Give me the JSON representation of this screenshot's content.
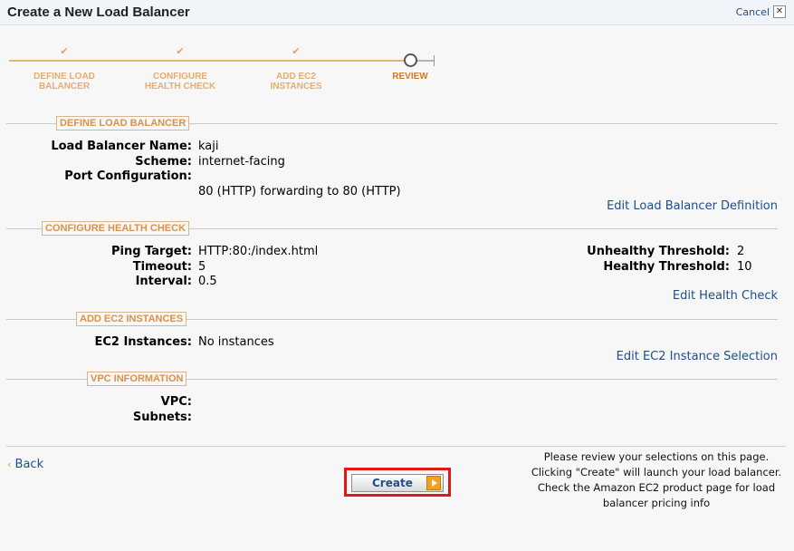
{
  "header": {
    "title": "Create a New Load Balancer",
    "cancel_label": "Cancel",
    "close_glyph": "✕"
  },
  "wizard": {
    "check_glyph": "✔",
    "steps": [
      {
        "line1": "DEFINE LOAD",
        "line2": "BALANCER",
        "status": "complete"
      },
      {
        "line1": "CONFIGURE",
        "line2": "HEALTH CHECK",
        "status": "complete"
      },
      {
        "line1": "ADD EC2",
        "line2": "INSTANCES",
        "status": "complete"
      },
      {
        "line1": "REVIEW",
        "line2": "",
        "status": "current"
      }
    ]
  },
  "sections": {
    "define": {
      "title": "DEFINE LOAD BALANCER",
      "name_label": "Load Balancer Name:",
      "name_value": "kaji",
      "scheme_label": "Scheme:",
      "scheme_value": "internet-facing",
      "port_label": "Port Configuration:",
      "port_value": "80 (HTTP) forwarding to 80 (HTTP)",
      "edit_link": "Edit Load Balancer Definition"
    },
    "health": {
      "title": "CONFIGURE HEALTH CHECK",
      "ping_label": "Ping Target:",
      "ping_value": "HTTP:80:/index.html",
      "timeout_label": "Timeout:",
      "timeout_value": "5",
      "interval_label": "Interval:",
      "interval_value": "0.5",
      "unhealthy_label": "Unhealthy Threshold:",
      "unhealthy_value": "2",
      "healthy_label": "Healthy Threshold:",
      "healthy_value": "10",
      "edit_link": "Edit Health Check"
    },
    "ec2": {
      "title": "ADD EC2 INSTANCES",
      "instances_label": "EC2 Instances:",
      "instances_value": "No instances",
      "edit_link": "Edit EC2 Instance Selection"
    },
    "vpc": {
      "title": "VPC INFORMATION",
      "vpc_label": "VPC:",
      "subnets_label": "Subnets:"
    }
  },
  "footer": {
    "back_arrow": "‹",
    "back_label": "Back",
    "create_label": "Create",
    "note_lines": [
      "Please review your selections on this page.",
      "Clicking \"Create\" will launch your load balancer.",
      "Check the Amazon EC2 product page for load",
      "balancer pricing info"
    ]
  },
  "colors": {
    "accent": "#e3ad74",
    "link": "#1e4e8c",
    "highlight": "#e01818",
    "button_arrow": "#f2a01d"
  }
}
